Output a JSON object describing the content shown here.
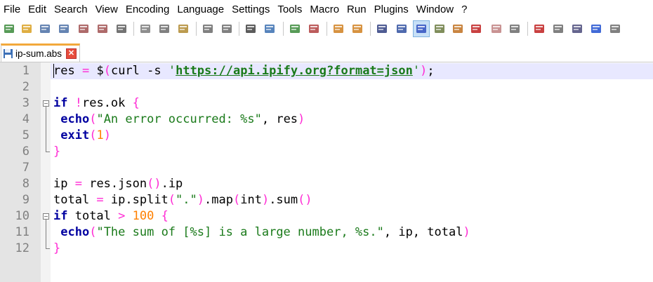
{
  "menu": [
    "File",
    "Edit",
    "Search",
    "View",
    "Encoding",
    "Language",
    "Settings",
    "Tools",
    "Macro",
    "Run",
    "Plugins",
    "Window",
    "?"
  ],
  "toolbar_icons": [
    "new-file-icon",
    "open-file-icon",
    "save-icon",
    "save-all-icon",
    "close-icon",
    "close-all-icon",
    "print-icon",
    "cut-icon",
    "copy-icon",
    "paste-icon",
    "undo-icon",
    "redo-icon",
    "find-icon",
    "replace-icon",
    "zoom-in-icon",
    "zoom-out-icon",
    "sync-vertical-icon",
    "sync-horizontal-icon",
    "word-wrap-icon",
    "show-all-chars-icon",
    "indent-guide-icon",
    "user-language-icon",
    "doc-map-icon",
    "function-list-icon",
    "folder-workspace-icon",
    "monitor-icon",
    "record-macro-icon",
    "stop-record-icon",
    "play-macro-icon",
    "run-macro-multiple-icon",
    "save-macro-icon"
  ],
  "tab": {
    "title": "ip-sum.abs"
  },
  "colors": {
    "keyword": "#0000a0",
    "string": "#1a7a1a",
    "number": "#ff8000",
    "operator": "#ff2ad4",
    "current_line": "#e8e8ff",
    "gutter": "#e4e4e4",
    "tab_accent": "#f2a93b"
  },
  "editor": {
    "lines": [
      {
        "n": "1",
        "tokens": [
          [
            "",
            "res "
          ],
          [
            "pun",
            "="
          ],
          [
            "",
            " "
          ],
          [
            "",
            "$"
          ],
          [
            "pun",
            "("
          ],
          [
            "",
            "curl -s "
          ],
          [
            "str",
            "'"
          ],
          [
            "url",
            "https://api.ipify.org?format=json"
          ],
          [
            "str",
            "'"
          ],
          [
            "pun",
            ")"
          ],
          [
            "",
            ";"
          ]
        ]
      },
      {
        "n": "2",
        "tokens": []
      },
      {
        "n": "3",
        "tokens": [
          [
            "kw",
            "if"
          ],
          [
            "",
            " "
          ],
          [
            "pun",
            "!"
          ],
          [
            "",
            "res.ok "
          ],
          [
            "pun",
            "{"
          ]
        ]
      },
      {
        "n": "4",
        "tokens": [
          [
            "",
            " "
          ],
          [
            "kw",
            "echo"
          ],
          [
            "pun",
            "("
          ],
          [
            "str",
            "\"An error occurred: %s\""
          ],
          [
            "",
            ", res"
          ],
          [
            "pun",
            ")"
          ]
        ]
      },
      {
        "n": "5",
        "tokens": [
          [
            "",
            " "
          ],
          [
            "kw",
            "exit"
          ],
          [
            "pun",
            "("
          ],
          [
            "num",
            "1"
          ],
          [
            "pun",
            ")"
          ]
        ]
      },
      {
        "n": "6",
        "tokens": [
          [
            "pun",
            "}"
          ]
        ]
      },
      {
        "n": "7",
        "tokens": []
      },
      {
        "n": "8",
        "tokens": [
          [
            "",
            "ip "
          ],
          [
            "pun",
            "="
          ],
          [
            "",
            " res.json"
          ],
          [
            "pun",
            "()"
          ],
          [
            "",
            ".ip"
          ]
        ]
      },
      {
        "n": "9",
        "tokens": [
          [
            "",
            "total "
          ],
          [
            "pun",
            "="
          ],
          [
            "",
            " ip.split"
          ],
          [
            "pun",
            "("
          ],
          [
            "str",
            "\".\""
          ],
          [
            "pun",
            ")"
          ],
          [
            "",
            ".map"
          ],
          [
            "pun",
            "("
          ],
          [
            "",
            "int"
          ],
          [
            "pun",
            ")"
          ],
          [
            "",
            ".sum"
          ],
          [
            "pun",
            "()"
          ]
        ]
      },
      {
        "n": "10",
        "tokens": [
          [
            "kw",
            "if"
          ],
          [
            "",
            " total "
          ],
          [
            "pun",
            ">"
          ],
          [
            "",
            " "
          ],
          [
            "num",
            "100"
          ],
          [
            "",
            " "
          ],
          [
            "pun",
            "{"
          ]
        ]
      },
      {
        "n": "11",
        "tokens": [
          [
            "",
            " "
          ],
          [
            "kw",
            "echo"
          ],
          [
            "pun",
            "("
          ],
          [
            "str",
            "\"The sum of [%s] is a large number, %s.\""
          ],
          [
            "",
            ", ip, total"
          ],
          [
            "pun",
            ")"
          ]
        ]
      },
      {
        "n": "12",
        "tokens": [
          [
            "pun",
            "}"
          ]
        ]
      }
    ]
  }
}
